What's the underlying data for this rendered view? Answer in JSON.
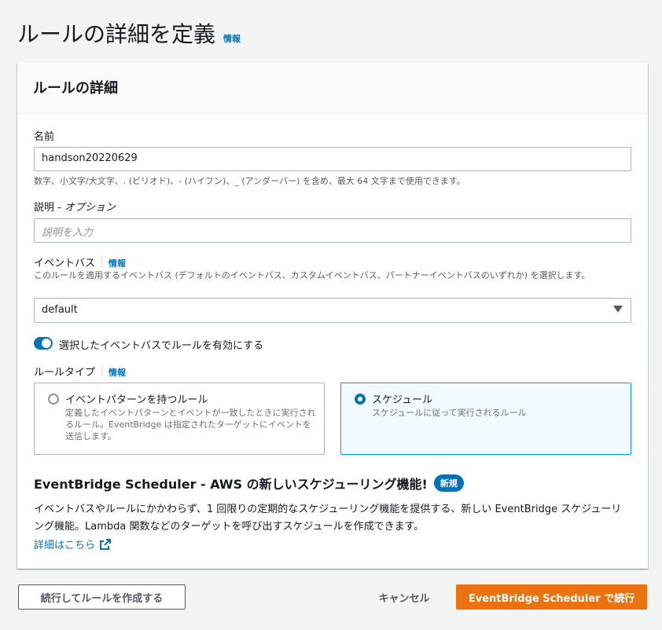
{
  "page": {
    "title": "ルールの詳細を定義",
    "info": "情報"
  },
  "panel": {
    "title": "ルールの詳細"
  },
  "name_field": {
    "label": "名前",
    "value": "handson20220629",
    "hint": "数字、小文字/大文字、. (ピリオド)、- (ハイフン)、_ (アンダーバー) を含め、最大 64 文字まで使用できます。"
  },
  "description_field": {
    "label": "説明 - ",
    "label_optional": "オプション",
    "placeholder": "説明を入力"
  },
  "event_bus": {
    "label": "イベントバス",
    "info": "情報",
    "hint": "このルールを適用するイベントバス (デフォルトのイベントバス、カスタムイベントバス、パートナーイベントバスのいずれか) を選択します。",
    "selected": "default"
  },
  "toggle": {
    "label": "選択したイベントバスでルールを有効にする",
    "enabled": true
  },
  "rule_type": {
    "label": "ルールタイプ",
    "info": "情報",
    "options": [
      {
        "title": "イベントパターンを持つルール",
        "desc": "定義したイベントパターンとイベントが一致したときに実行されるルール。EventBridge は指定されたターゲットにイベントを送信します。",
        "selected": false
      },
      {
        "title": "スケジュール",
        "desc": "スケジュールに従って実行されるルール",
        "selected": true
      }
    ]
  },
  "promo": {
    "title": "EventBridge Scheduler - AWS の新しいスケジューリング機能!",
    "badge": "新規",
    "body": "イベントバスやルールにかかわらず、1 回限りの定期的なスケジューリング機能を提供する、新しい EventBridge スケジューリング機能。Lambda 関数などのターゲットを呼び出すスケジュールを作成できます。",
    "link": "詳細はこちら"
  },
  "footer": {
    "continue_rule": "続行してルールを作成する",
    "cancel": "キャンセル",
    "continue_scheduler": "EventBridge Scheduler で続行"
  },
  "colors": {
    "accent": "#0073bb",
    "primary_button": "#ec7211"
  }
}
